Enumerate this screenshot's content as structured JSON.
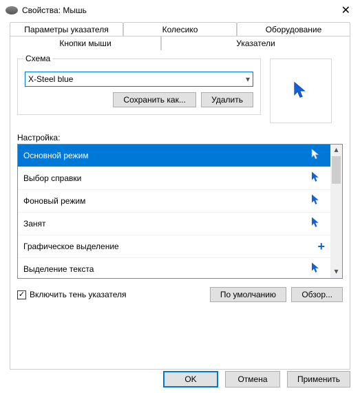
{
  "window": {
    "title": "Свойства: Мышь"
  },
  "tabs_row1": [
    {
      "label": "Параметры указателя"
    },
    {
      "label": "Колесико"
    },
    {
      "label": "Оборудование"
    }
  ],
  "tabs_row2": [
    {
      "label": "Кнопки мыши"
    },
    {
      "label": "Указатели"
    }
  ],
  "scheme": {
    "label": "Схема",
    "selected": "X-Steel blue",
    "save_as": "Сохранить как...",
    "delete": "Удалить"
  },
  "customize_label": "Настройка:",
  "pointer_list": [
    {
      "label": "Основной режим",
      "icon": "cursor-arrow",
      "color": "white"
    },
    {
      "label": "Выбор справки",
      "icon": "cursor-arrow",
      "color": "blue"
    },
    {
      "label": "Фоновый режим",
      "icon": "cursor-arrow",
      "color": "blue"
    },
    {
      "label": "Занят",
      "icon": "cursor-arrow",
      "color": "blue"
    },
    {
      "label": "Графическое выделение",
      "icon": "precision",
      "color": "blue"
    },
    {
      "label": "Выделение текста",
      "icon": "cursor-arrow",
      "color": "blue"
    }
  ],
  "shadow": {
    "label": "Включить тень указателя",
    "checked": true
  },
  "defaults_btn": "По умолчанию",
  "browse_btn": "Обзор...",
  "footer": {
    "ok": "OK",
    "cancel": "Отмена",
    "apply": "Применить"
  }
}
